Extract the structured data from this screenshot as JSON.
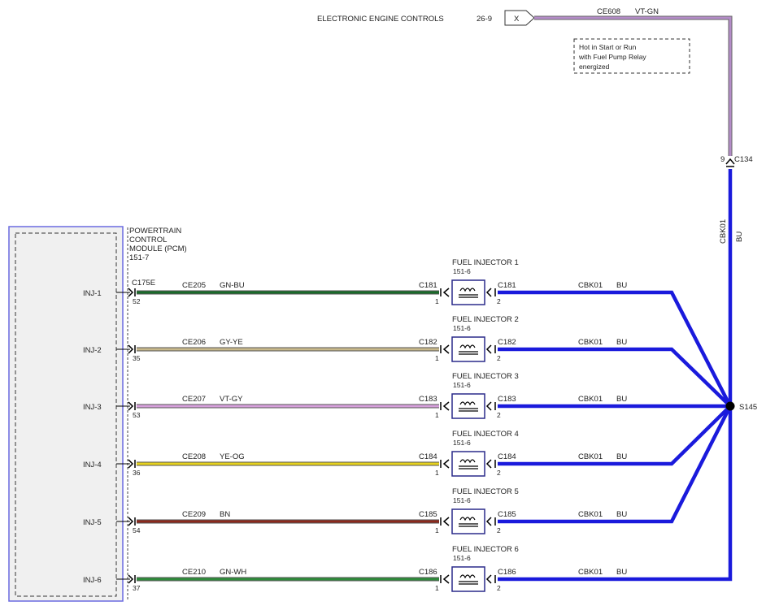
{
  "header": {
    "target_label": "ELECTRONIC ENGINE CONTROLS",
    "target_ref": "26-9",
    "connector_x": "X",
    "circuit": "CE608",
    "color": "VT-GN"
  },
  "note": {
    "line1": "Hot in Start or Run",
    "line2": "with Fuel Pump Relay",
    "line3": "energized"
  },
  "c134": {
    "pin": "9",
    "name": "C134"
  },
  "vertical_bus": {
    "circuit": "CBK01",
    "color": "BU"
  },
  "splice": "S145",
  "pcm": {
    "line1": "POWERTRAIN",
    "line2": "CONTROL",
    "line3": "MODULE (PCM)",
    "ref": "151-7",
    "connector": "C175E"
  },
  "injectors": [
    {
      "pcm_pin_label": "INJ-1",
      "pcm_pin": "52",
      "circuit": "CE205",
      "color": "GN-BU",
      "conn": "C181",
      "pin1": "1",
      "pin2": "2",
      "name": "FUEL INJECTOR 1",
      "ref": "151-6",
      "out_circuit": "CBK01",
      "out_color": "BU"
    },
    {
      "pcm_pin_label": "INJ-2",
      "pcm_pin": "35",
      "circuit": "CE206",
      "color": "GY-YE",
      "conn": "C182",
      "pin1": "1",
      "pin2": "2",
      "name": "FUEL INJECTOR 2",
      "ref": "151-6",
      "out_circuit": "CBK01",
      "out_color": "BU"
    },
    {
      "pcm_pin_label": "INJ-3",
      "pcm_pin": "53",
      "circuit": "CE207",
      "color": "VT-GY",
      "conn": "C183",
      "pin1": "1",
      "pin2": "2",
      "name": "FUEL INJECTOR 3",
      "ref": "151-6",
      "out_circuit": "CBK01",
      "out_color": "BU"
    },
    {
      "pcm_pin_label": "INJ-4",
      "pcm_pin": "36",
      "circuit": "CE208",
      "color": "YE-OG",
      "conn": "C184",
      "pin1": "1",
      "pin2": "2",
      "name": "FUEL INJECTOR 4",
      "ref": "151-6",
      "out_circuit": "CBK01",
      "out_color": "BU"
    },
    {
      "pcm_pin_label": "INJ-5",
      "pcm_pin": "54",
      "circuit": "CE209",
      "color": "BN",
      "conn": "C185",
      "pin1": "1",
      "pin2": "2",
      "name": "FUEL INJECTOR 5",
      "ref": "151-6",
      "out_circuit": "CBK01",
      "out_color": "BU"
    },
    {
      "pcm_pin_label": "INJ-6",
      "pcm_pin": "37",
      "circuit": "CE210",
      "color": "GN-WH",
      "conn": "C186",
      "pin1": "1",
      "pin2": "2",
      "name": "FUEL INJECTOR 6",
      "ref": "151-6",
      "out_circuit": "CBK01",
      "out_color": "BU"
    }
  ],
  "wire_colors": {
    "bus": "#1a1adc",
    "top": "#b48cc8",
    "GN-BU": "#1a6b2a",
    "GY-YE": "#c8b88a",
    "VT-GY": "#d7a0dc",
    "YE-OG": "#e6d21e",
    "BN": "#8c2a1e",
    "GN-WH": "#2e8b3a"
  }
}
